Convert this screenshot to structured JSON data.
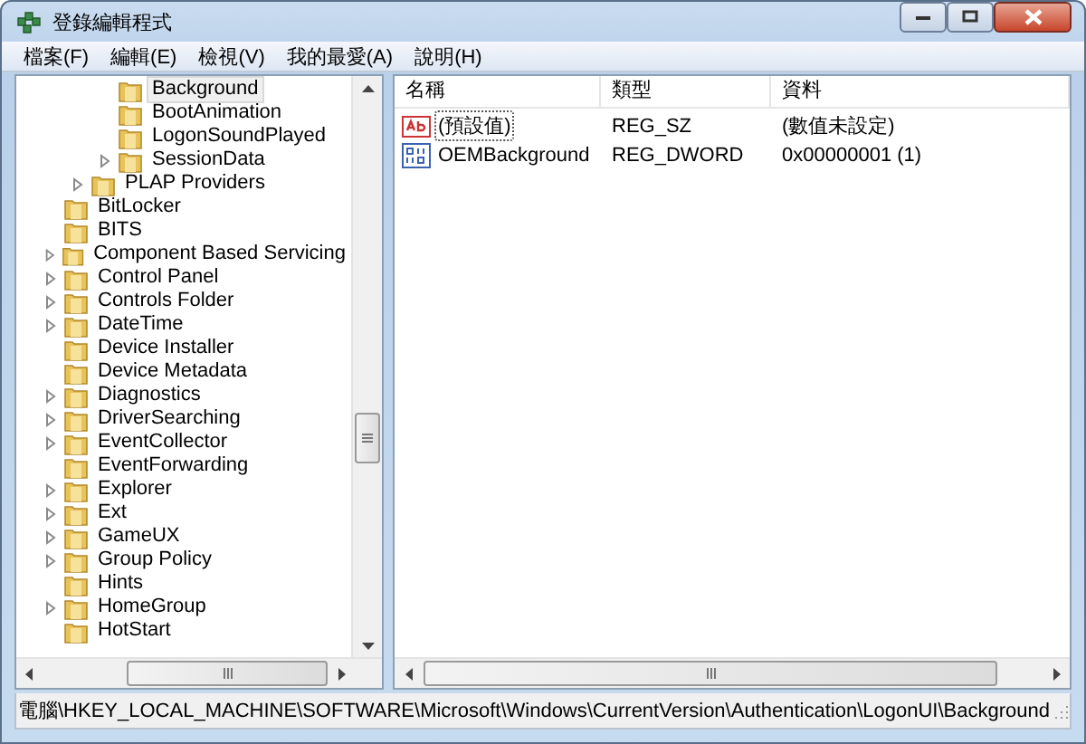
{
  "window": {
    "title": "登錄編輯程式"
  },
  "menu": [
    {
      "label": "檔案(F)"
    },
    {
      "label": "編輯(E)"
    },
    {
      "label": "檢視(V)"
    },
    {
      "label": "我的最愛(A)"
    },
    {
      "label": "說明(H)"
    }
  ],
  "tree": {
    "items": [
      {
        "children": [
          {
            "children": [
              {
                "label": "Background",
                "expandable": false,
                "selected": true
              },
              {
                "label": "BootAnimation",
                "expandable": false,
                "selected": false
              },
              {
                "label": "LogonSoundPlayed",
                "expandable": false,
                "selected": false
              },
              {
                "label": "SessionData",
                "expandable": true,
                "selected": false
              }
            ]
          },
          {
            "label": "PLAP Providers",
            "expandable": true,
            "selected": false
          }
        ]
      },
      {
        "label": "BitLocker",
        "expandable": false,
        "selected": false
      },
      {
        "label": "BITS",
        "expandable": false,
        "selected": false
      },
      {
        "label": "Component Based Servicing",
        "expandable": true,
        "selected": false
      },
      {
        "label": "Control Panel",
        "expandable": true,
        "selected": false
      },
      {
        "label": "Controls Folder",
        "expandable": true,
        "selected": false
      },
      {
        "label": "DateTime",
        "expandable": true,
        "selected": false
      },
      {
        "label": "Device Installer",
        "expandable": false,
        "selected": false
      },
      {
        "label": "Device Metadata",
        "expandable": false,
        "selected": false
      },
      {
        "label": "Diagnostics",
        "expandable": true,
        "selected": false
      },
      {
        "label": "DriverSearching",
        "expandable": true,
        "selected": false
      },
      {
        "label": "EventCollector",
        "expandable": true,
        "selected": false
      },
      {
        "label": "EventForwarding",
        "expandable": false,
        "selected": false
      },
      {
        "label": "Explorer",
        "expandable": true,
        "selected": false
      },
      {
        "label": "Ext",
        "expandable": true,
        "selected": false
      },
      {
        "label": "GameUX",
        "expandable": true,
        "selected": false
      },
      {
        "label": "Group Policy",
        "expandable": true,
        "selected": false
      },
      {
        "label": "Hints",
        "expandable": false,
        "selected": false
      },
      {
        "label": "HomeGroup",
        "expandable": true,
        "selected": false
      },
      {
        "label": "HotStart",
        "expandable": false,
        "selected": false
      }
    ]
  },
  "values": {
    "columns": [
      "名稱",
      "類型",
      "資料"
    ],
    "rows": [
      {
        "kind": "string",
        "name": "(預設值)",
        "type": "REG_SZ",
        "data": "(數值未設定)",
        "selected": true
      },
      {
        "kind": "binary",
        "name": "OEMBackground",
        "type": "REG_DWORD",
        "data": "0x00000001 (1)",
        "selected": false
      }
    ]
  },
  "status_bar": {
    "path": "電腦\\HKEY_LOCAL_MACHINE\\SOFTWARE\\Microsoft\\Windows\\CurrentVersion\\Authentication\\LogonUI\\Background"
  }
}
